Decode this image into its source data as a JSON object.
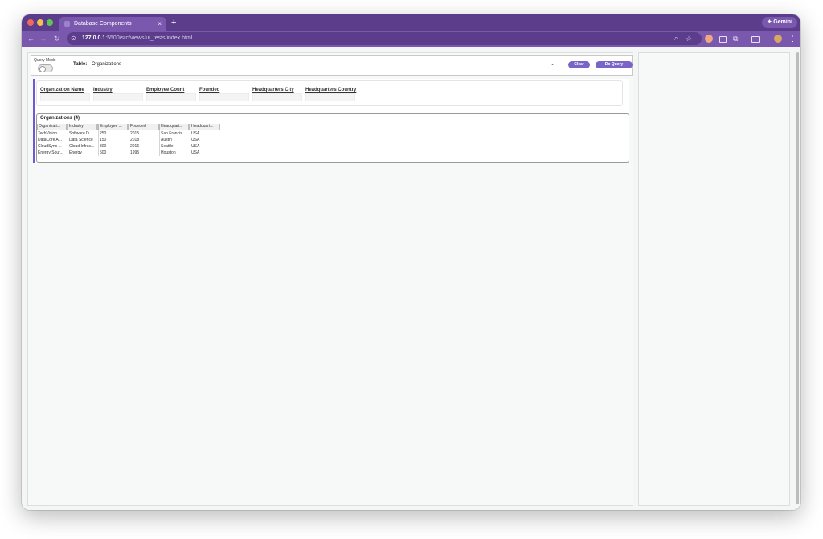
{
  "browser": {
    "tab_title": "Database Components",
    "tab_close": "×",
    "new_tab": "+",
    "gemini_label": "✦ Gemini",
    "url_host": "127.0.0.1",
    "url_path": ":5500/src/views/ui_tests/index.html"
  },
  "query_bar": {
    "query_mode_label": "Query Mode",
    "query_mode_on": false,
    "table_label": "Table:",
    "table_selected": "Organizations",
    "clear_label": "Clear",
    "do_query_label": "Do Query"
  },
  "filters": [
    "Organization Name",
    "Industry",
    "Employee Count",
    "Founded",
    "Headquarters City",
    "Headquarters Country"
  ],
  "results": {
    "title": "Organizations (4)",
    "columns": [
      "Organizati...",
      "Industry",
      "Employee ...",
      "Founded",
      "Headquart...",
      "Headquart..."
    ],
    "rows": [
      [
        "TechVision ...",
        "Software D...",
        "250",
        "2015",
        "San Francis...",
        "USA"
      ],
      [
        "DataCore A...",
        "Data Science",
        "150",
        "2018",
        "Austin",
        "USA"
      ],
      [
        "CloudSync ...",
        "Cloud Infras...",
        "300",
        "2016",
        "Seattle",
        "USA"
      ],
      [
        "Energy Sour...",
        "Energy",
        "500",
        "1995",
        "Houston",
        "USA"
      ]
    ]
  },
  "colors": {
    "browser_frame": "#5b3d8c",
    "browser_toolbar": "#7a58ad",
    "accent_button": "#7a64c8",
    "results_border": "#6c5ad4"
  }
}
